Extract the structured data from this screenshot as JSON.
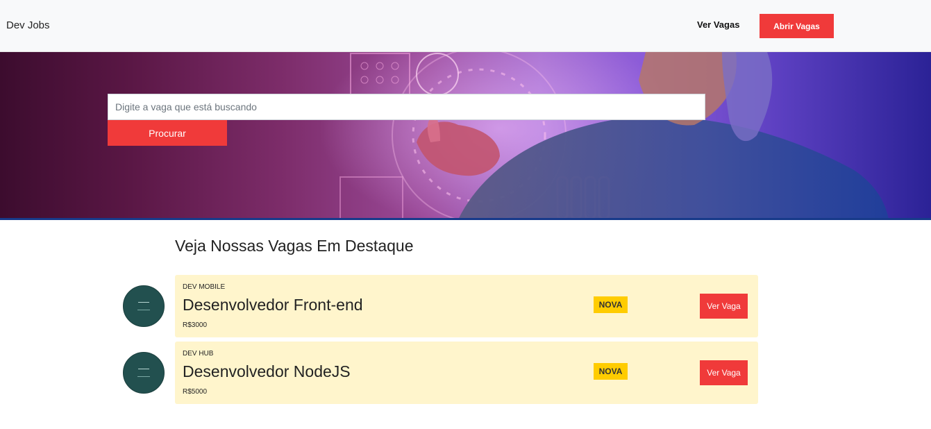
{
  "navbar": {
    "brand": "Dev Jobs",
    "link_label": "Ver Vagas",
    "button_label": "Abrir Vagas"
  },
  "hero": {
    "search_placeholder": "Digite a vaga que está buscando",
    "search_button_label": "Procurar",
    "accent_color": "#f03a3a"
  },
  "section": {
    "title": "Veja Nossas Vagas Em Destaque"
  },
  "jobs": [
    {
      "company": "DEV MOBILE",
      "title": "Desenvolvedor Front-end",
      "salary": "R$3000",
      "badge": "NOVA",
      "button_label": "Ver Vaga"
    },
    {
      "company": "DEV HUB",
      "title": "Desenvolvedor NodeJS",
      "salary": "R$5000",
      "badge": "NOVA",
      "button_label": "Ver Vaga"
    }
  ],
  "colors": {
    "card_background": "#fff5cc",
    "badge": "#ffcc00",
    "logo_background": "#22504f"
  }
}
